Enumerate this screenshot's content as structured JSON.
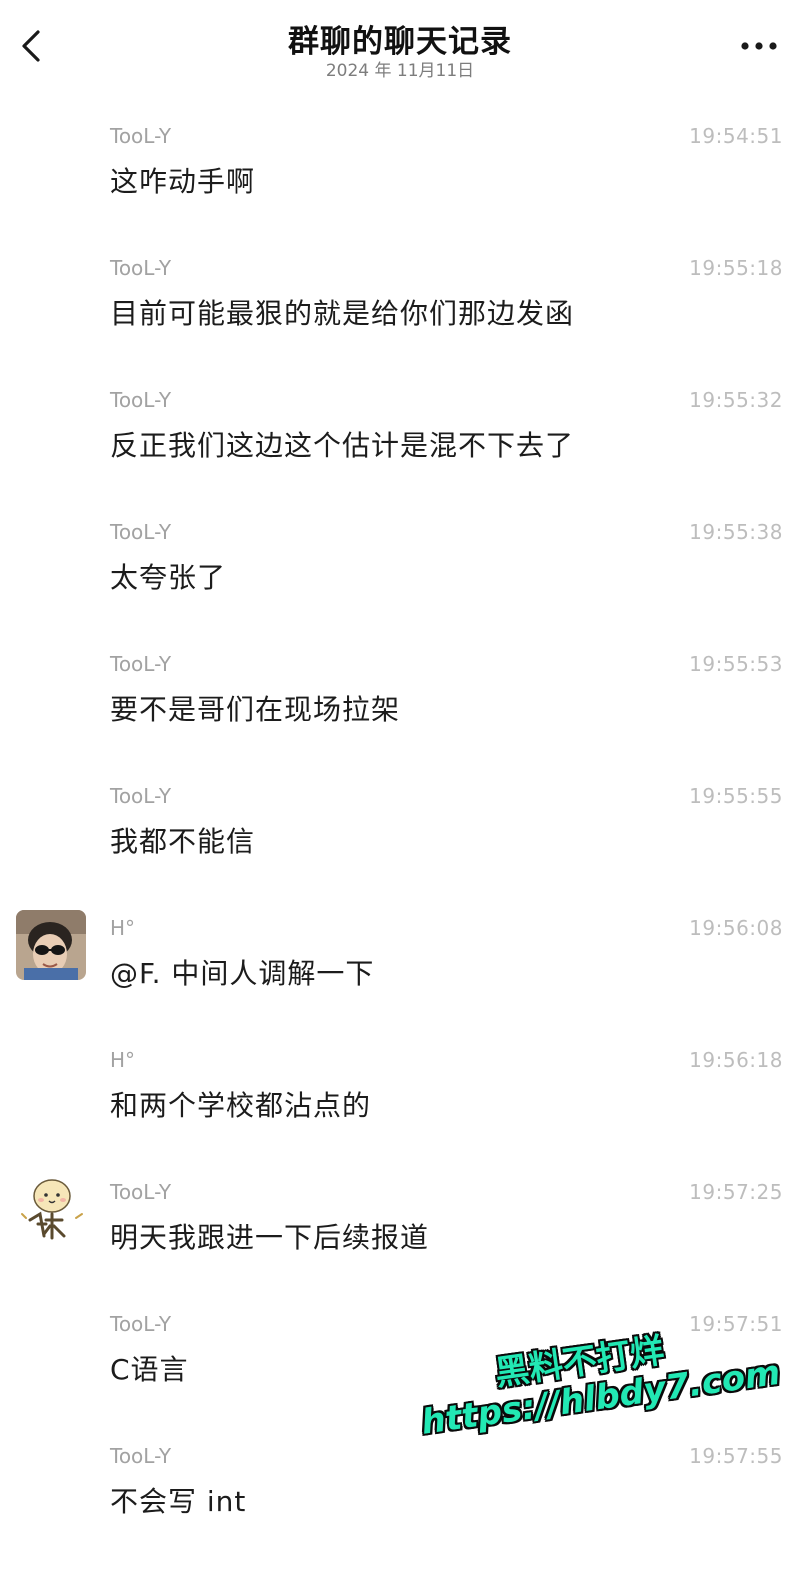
{
  "header": {
    "title": "群聊的聊天记录",
    "date": "2024 年 11月11日",
    "back_icon": "chevron-left-icon",
    "more_icon": "more-dots-icon"
  },
  "messages": [
    {
      "sender": "TooL-Y",
      "time": "19:54:51",
      "text": "这咋动手啊",
      "avatar": "none"
    },
    {
      "sender": "TooL-Y",
      "time": "19:55:18",
      "text": "目前可能最狠的就是给你们那边发函",
      "avatar": "none"
    },
    {
      "sender": "TooL-Y",
      "time": "19:55:32",
      "text": "反正我们这边这个估计是混不下去了",
      "avatar": "none"
    },
    {
      "sender": "TooL-Y",
      "time": "19:55:38",
      "text": "太夸张了",
      "avatar": "none"
    },
    {
      "sender": "TooL-Y",
      "time": "19:55:53",
      "text": "要不是哥们在现场拉架",
      "avatar": "none"
    },
    {
      "sender": "TooL-Y",
      "time": "19:55:55",
      "text": "我都不能信",
      "avatar": "none"
    },
    {
      "sender": "H°",
      "time": "19:56:08",
      "text": "@F. 中间人调解一下",
      "avatar": "photo-avatar"
    },
    {
      "sender": "H°",
      "time": "19:56:18",
      "text": "和两个学校都沾点的",
      "avatar": "none"
    },
    {
      "sender": "TooL-Y",
      "time": "19:57:25",
      "text": "明天我跟进一下后续报道",
      "avatar": "cartoon-avatar"
    },
    {
      "sender": "TooL-Y",
      "time": "19:57:51",
      "text": "C语言",
      "avatar": "none"
    },
    {
      "sender": "TooL-Y",
      "time": "19:57:55",
      "text": "不会写 int",
      "avatar": "none"
    }
  ],
  "watermark": {
    "line1": "黑料不打烊",
    "line2": "https://hlbdy7.com",
    "color": "#22e8b4"
  },
  "colors": {
    "background": "#ffffff",
    "sender": "#a2a2a2",
    "time": "#bdbdbd",
    "text": "#1c1c1c"
  }
}
